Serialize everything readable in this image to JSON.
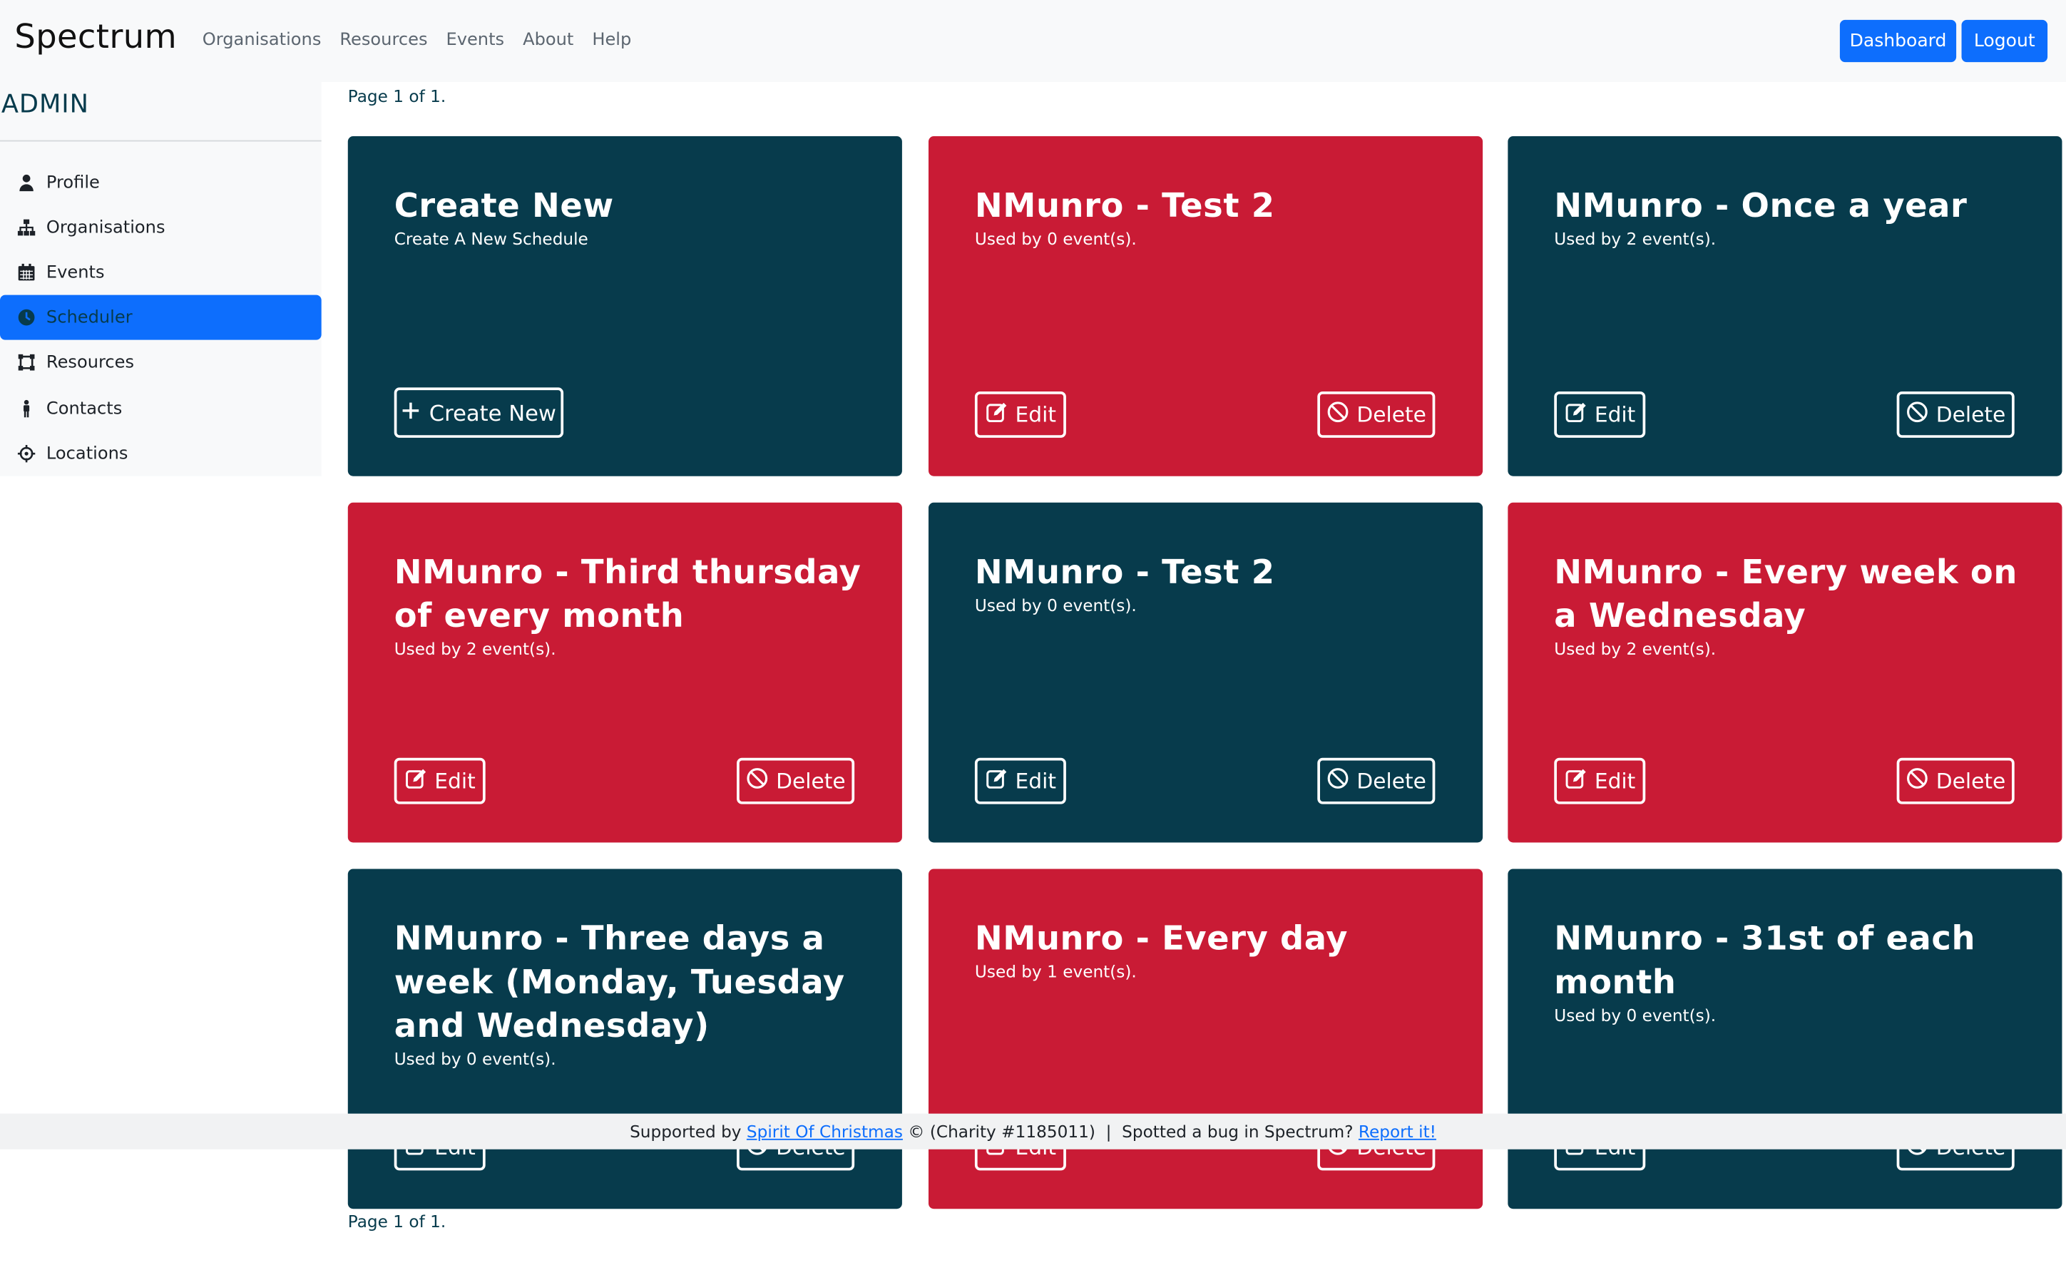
{
  "navbar": {
    "brand": "Spectrum",
    "links": [
      "Organisations",
      "Resources",
      "Events",
      "About",
      "Help"
    ],
    "dashboard_label": "Dashboard",
    "logout_label": "Logout"
  },
  "sidebar": {
    "title": "ADMIN",
    "items": [
      {
        "label": "Profile",
        "icon": "user-icon"
      },
      {
        "label": "Organisations",
        "icon": "sitemap-icon"
      },
      {
        "label": "Events",
        "icon": "calendar-icon"
      },
      {
        "label": "Scheduler",
        "icon": "clock-icon",
        "active": true
      },
      {
        "label": "Resources",
        "icon": "vector-square-icon"
      },
      {
        "label": "Contacts",
        "icon": "person-icon"
      },
      {
        "label": "Locations",
        "icon": "crosshairs-icon"
      }
    ]
  },
  "pagination": {
    "top": "Page 1 of 1.",
    "bottom": "Page 1 of 1."
  },
  "create_card": {
    "title": "Create New",
    "subtitle": "Create A New Schedule",
    "button_label": "Create New"
  },
  "buttons": {
    "edit_label": "Edit",
    "delete_label": "Delete"
  },
  "schedules": [
    {
      "title": "NMunro - Test 2",
      "usage": "Used by 0 event(s)."
    },
    {
      "title": "NMunro - Once a year",
      "usage": "Used by 2 event(s)."
    },
    {
      "title": "NMunro - Third thursday of every month",
      "usage": "Used by 2 event(s)."
    },
    {
      "title": "NMunro - Test 2",
      "usage": "Used by 0 event(s)."
    },
    {
      "title": "NMunro - Every week on a Wednesday",
      "usage": "Used by 2 event(s)."
    },
    {
      "title": "NMunro - Three days a week (Monday, Tuesday and Wednesday)",
      "usage": "Used by 0 event(s)."
    },
    {
      "title": "NMunro - Every day",
      "usage": "Used by 1 event(s)."
    },
    {
      "title": "NMunro - 31st of each month",
      "usage": "Used by 0 event(s)."
    }
  ],
  "footer": {
    "prefix": "Supported by",
    "charity_link": "Spirit Of Christmas",
    "middle": "© (Charity #1185011)  |  Spotted a bug in Spectrum?",
    "report_link": "Report it!"
  },
  "colors": {
    "dark_card": "#073b4c",
    "red_card": "#c91b35",
    "primary": "#0d6efd"
  }
}
